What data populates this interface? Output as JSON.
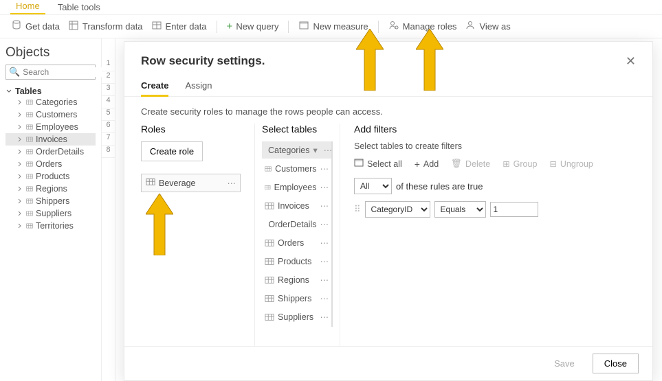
{
  "ribbon": {
    "tabs": {
      "home": "Home",
      "table_tools": "Table tools"
    },
    "actions": {
      "get_data": "Get data",
      "transform": "Transform data",
      "enter_data": "Enter data",
      "new_query": "New query",
      "new_measure": "New measure",
      "manage_roles": "Manage roles",
      "view_as": "View as"
    }
  },
  "objects": {
    "title": "Objects",
    "search_placeholder": "Search",
    "root": "Tables",
    "items": [
      {
        "label": "Categories"
      },
      {
        "label": "Customers"
      },
      {
        "label": "Employees"
      },
      {
        "label": "Invoices",
        "selected": true
      },
      {
        "label": "OrderDetails"
      },
      {
        "label": "Orders"
      },
      {
        "label": "Products"
      },
      {
        "label": "Regions"
      },
      {
        "label": "Shippers"
      },
      {
        "label": "Suppliers"
      },
      {
        "label": "Territories"
      }
    ]
  },
  "rownums": [
    "1",
    "2",
    "3",
    "4",
    "5",
    "6",
    "7",
    "8"
  ],
  "dialog": {
    "title": "Row security settings.",
    "tabs": {
      "create": "Create",
      "assign": "Assign"
    },
    "subtitle": "Create security roles to manage the rows people can access.",
    "roles_heading": "Roles",
    "create_role_btn": "Create role",
    "role_name": "Beverage",
    "tables_heading": "Select tables",
    "select_tables": [
      {
        "label": "Categories",
        "selected": true
      },
      {
        "label": "Customers"
      },
      {
        "label": "Employees"
      },
      {
        "label": "Invoices"
      },
      {
        "label": "OrderDetails"
      },
      {
        "label": "Orders"
      },
      {
        "label": "Products"
      },
      {
        "label": "Regions"
      },
      {
        "label": "Shippers"
      },
      {
        "label": "Suppliers"
      }
    ],
    "filters_heading": "Add filters",
    "filters_sub": "Select tables to create filters",
    "toolbar": {
      "select_all": "Select all",
      "add": "Add",
      "delete": "Delete",
      "group": "Group",
      "ungroup": "Ungroup"
    },
    "rule_header": {
      "all": "All",
      "suffix": "of these rules are true"
    },
    "rule": {
      "field": "CategoryID",
      "op": "Equals",
      "value": "1"
    },
    "footer": {
      "save": "Save",
      "close": "Close"
    }
  }
}
